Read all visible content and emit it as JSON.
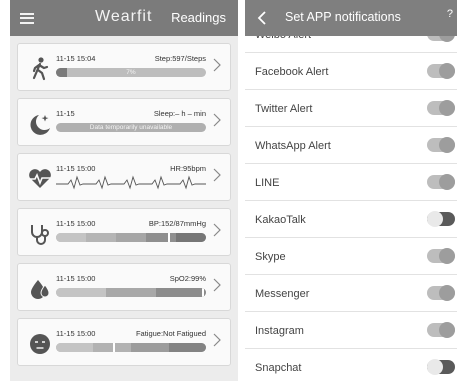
{
  "left": {
    "header": {
      "app_title": "Wearfit",
      "readings_label": "Readings"
    },
    "cards": [
      {
        "kind": "steps",
        "date": "11-15 15:04",
        "value": "Step:597/Steps",
        "bar_text": "7%",
        "progress": 0.07
      },
      {
        "kind": "sleep",
        "date": "11-15",
        "value": "Sleep:– h – min",
        "bar_text": "Data temporarily unavailable"
      },
      {
        "kind": "heart_rate",
        "date": "11-15 15:00",
        "value": "HR:95bpm"
      },
      {
        "kind": "blood_pressure",
        "date": "11-15 15:00",
        "value": "BP:152/87mmHg"
      },
      {
        "kind": "spo2",
        "date": "11-15 15:00",
        "value": "SpO2:99%"
      },
      {
        "kind": "fatigue",
        "date": "11-15 15:00",
        "value": "Fatigue:Not Fatigued"
      }
    ]
  },
  "right": {
    "header": {
      "title": "Set APP notifications",
      "help_text": "?"
    },
    "items": [
      {
        "label": "Weibo Alert",
        "on": true
      },
      {
        "label": "Facebook Alert",
        "on": true
      },
      {
        "label": "Twitter Alert",
        "on": true
      },
      {
        "label": "WhatsApp Alert",
        "on": true
      },
      {
        "label": "LINE",
        "on": true
      },
      {
        "label": "KakaoTalk",
        "on": false
      },
      {
        "label": "Skype",
        "on": true
      },
      {
        "label": "Messenger",
        "on": true
      },
      {
        "label": "Instagram",
        "on": true
      },
      {
        "label": "Snapchat",
        "on": false
      }
    ]
  },
  "colors": {
    "header_bg": "#7b7b7b",
    "toggle_on_track": "#bdbdbd",
    "toggle_off_track": "#5a5a5a"
  }
}
